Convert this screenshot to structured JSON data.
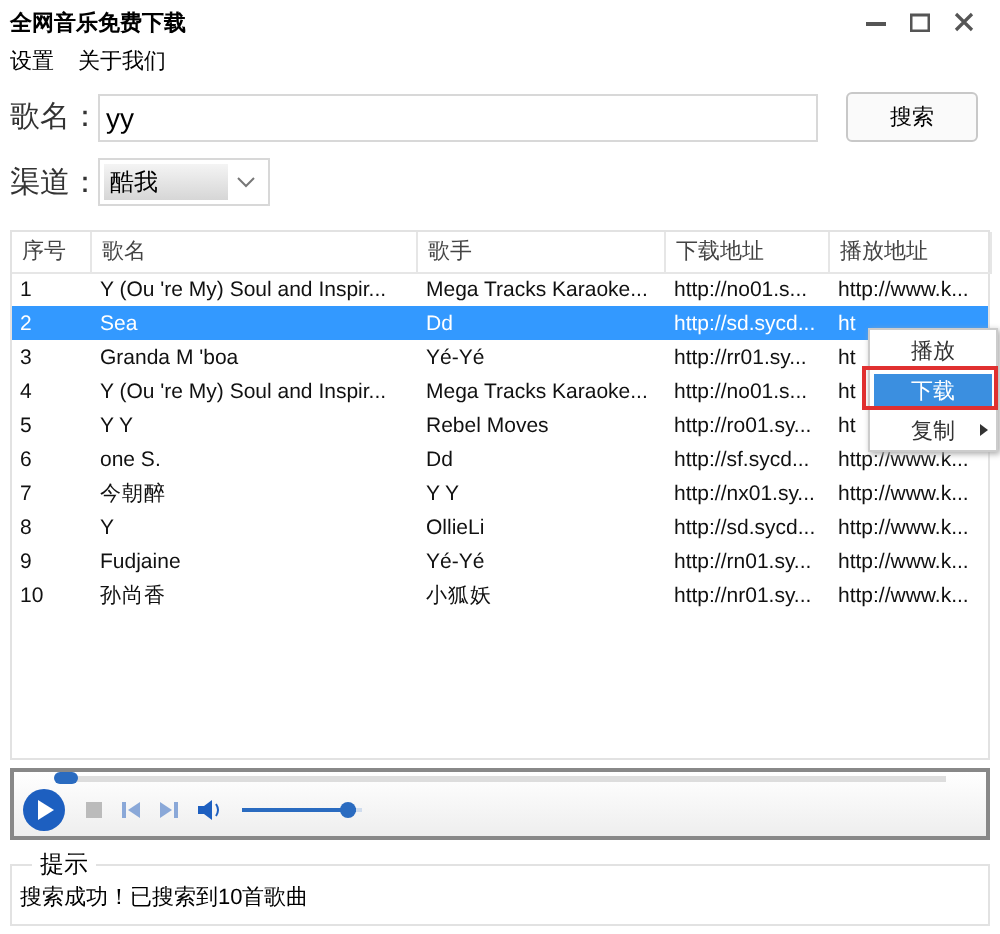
{
  "window": {
    "title": "全网音乐免费下载"
  },
  "menu": [
    "设置",
    "关于我们"
  ],
  "search": {
    "label": "歌名：",
    "value": "yy",
    "button": "搜索"
  },
  "channel": {
    "label": "渠道：",
    "value": "酷我"
  },
  "table": {
    "columns": [
      "序号",
      "歌名",
      "歌手",
      "下载地址",
      "播放地址"
    ],
    "rows": [
      {
        "selected": false,
        "cells": [
          "1",
          "Y (Ou  're My) Soul and Inspir...",
          "Mega Tracks Karaoke...",
          "http://no01.s...",
          "http://www.k..."
        ]
      },
      {
        "selected": true,
        "cells": [
          "2",
          "Sea",
          "Dd",
          "http://sd.sycd...",
          "ht"
        ]
      },
      {
        "selected": false,
        "cells": [
          "3",
          "Granda M  'boa",
          "Yé-Yé",
          "http://rr01.sy...",
          "ht"
        ]
      },
      {
        "selected": false,
        "cells": [
          "4",
          "Y (Ou  're My) Soul and Inspir...",
          "Mega Tracks Karaoke...",
          "http://no01.s...",
          "ht"
        ]
      },
      {
        "selected": false,
        "cells": [
          "5",
          "Y Y",
          "Rebel Moves",
          "http://ro01.sy...",
          "ht"
        ]
      },
      {
        "selected": false,
        "cells": [
          "6",
          "one S.",
          "Dd",
          "http://sf.sycd...",
          "http://www.k..."
        ]
      },
      {
        "selected": false,
        "cells": [
          "7",
          "今朝醉",
          " Y Y",
          "http://nx01.sy...",
          "http://www.k..."
        ]
      },
      {
        "selected": false,
        "cells": [
          "8",
          "Y",
          "OllieLi",
          "http://sd.sycd...",
          "http://www.k..."
        ]
      },
      {
        "selected": false,
        "cells": [
          "9",
          "Fudjaine",
          "Yé-Yé",
          "http://rn01.sy...",
          "http://www.k..."
        ]
      },
      {
        "selected": false,
        "cells": [
          "10",
          "孙尚香",
          "小狐妖",
          "http://nr01.sy...",
          "http://www.k..."
        ]
      }
    ]
  },
  "context_menu": {
    "items": [
      {
        "label": "播放",
        "selected": false,
        "submenu": false
      },
      {
        "label": "下载",
        "selected": true,
        "submenu": false
      },
      {
        "label": "复制",
        "selected": false,
        "submenu": true
      }
    ]
  },
  "player": {
    "seek": {
      "level": 0
    },
    "volume": {
      "level": 0.95
    }
  },
  "hint": {
    "title": "提示",
    "message": "搜索成功！已搜索到10首歌曲"
  }
}
